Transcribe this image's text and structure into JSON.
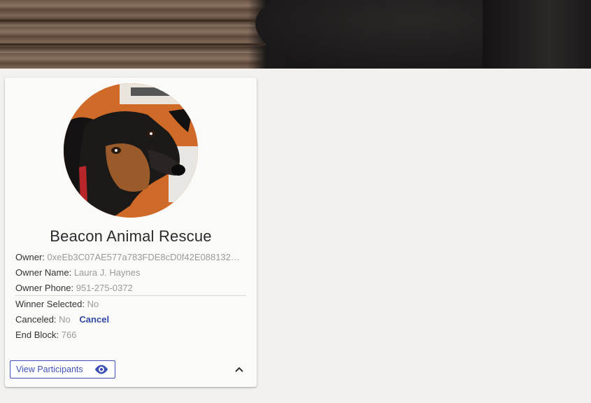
{
  "card": {
    "title": "Beacon Animal Rescue",
    "owner_label": "Owner:",
    "owner_value": "0xeEb3C07AE577a783FDE8cD0f42E0881329...",
    "owner_name_label": "Owner Name:",
    "owner_name_value": "Laura J. Haynes",
    "owner_phone_label": "Owner Phone:",
    "owner_phone_value": "951-275-0372",
    "winner_label": "Winner Selected:",
    "winner_value": "No",
    "canceled_label": "Canceled:",
    "canceled_value": "No",
    "cancel_action": "Cancel",
    "end_block_label": "End Block:",
    "end_block_value": "766",
    "view_participants": "View Participants"
  },
  "icons": {
    "eye": "eye-icon",
    "expand": "chevron-up-icon"
  },
  "colors": {
    "accent": "#3f51b5",
    "background": "#f2f1ef",
    "card": "#fafaf9"
  }
}
